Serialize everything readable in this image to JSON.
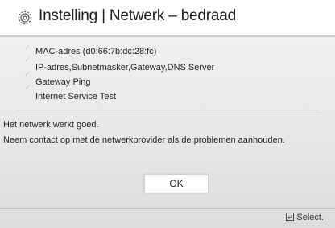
{
  "header": {
    "title": "Instelling | Netwerk – bedraad",
    "icon": "gear-icon"
  },
  "test_items": [
    {
      "label": "MAC-adres (d0:66:7b:dc:28:fc)"
    },
    {
      "label": "IP-adres,Subnetmasker,Gateway,DNS Server"
    },
    {
      "label": "Gateway Ping"
    },
    {
      "label": "Internet Service Test"
    }
  ],
  "messages": {
    "status": "Het netwerk werkt goed.",
    "advice": "Neem contact op met de netwerkprovider als de problemen aanhouden."
  },
  "ok_button": {
    "label": "OK"
  },
  "footer": {
    "hint": "Select.",
    "icon": "enter-icon"
  }
}
